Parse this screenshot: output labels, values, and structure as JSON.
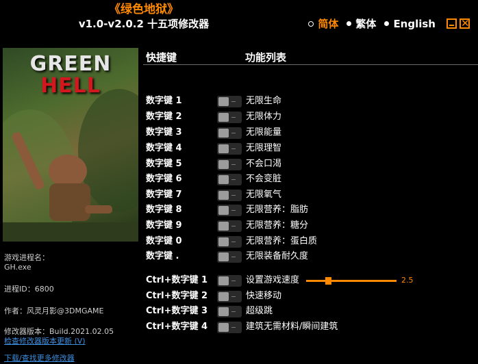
{
  "window": {
    "title_cn": "《绿色地狱》",
    "title_version": "v1.0-v2.0.2 十五项修改器"
  },
  "languages": [
    {
      "label": "简体",
      "selected": true
    },
    {
      "label": "繁体",
      "selected": false
    },
    {
      "label": "English",
      "selected": false
    }
  ],
  "cover": {
    "line1": "GREEN",
    "line2": "HELL"
  },
  "info": {
    "process_label": "游戏进程名：",
    "process_value": "GH.exe",
    "pid": "进程ID：6800",
    "author": "作者：风灵月影@3DMGAME",
    "build": "修改器版本：Build.2021.02.05",
    "check_update": "检查修改器版本更新 (V)",
    "download": "下载/查找更多修改器"
  },
  "headers": {
    "hotkey": "快捷键",
    "functions": "功能列表"
  },
  "cheats": [
    {
      "key": "数字键 1",
      "label": "无限生命"
    },
    {
      "key": "数字键 2",
      "label": "无限体力"
    },
    {
      "key": "数字键 3",
      "label": "无限能量"
    },
    {
      "key": "数字键 4",
      "label": "无限理智"
    },
    {
      "key": "数字键 5",
      "label": "不会口渴"
    },
    {
      "key": "数字键 6",
      "label": "不会变脏"
    },
    {
      "key": "数字键 7",
      "label": "无限氧气"
    },
    {
      "key": "数字键 8",
      "label": "无限营养：脂肪"
    },
    {
      "key": "数字键 9",
      "label": "无限营养：糖分"
    },
    {
      "key": "数字键 0",
      "label": "无限营养：蛋白质"
    },
    {
      "key": "数字键 .",
      "label": "无限装备耐久度"
    }
  ],
  "ctrl_cheats": [
    {
      "key": "Ctrl+数字键 1",
      "label": "设置游戏速度",
      "slider_value": "2.5"
    },
    {
      "key": "Ctrl+数字键 2",
      "label": "快速移动"
    },
    {
      "key": "Ctrl+数字键 3",
      "label": "超级跳"
    },
    {
      "key": "Ctrl+数字键 4",
      "label": "建筑无需材料/瞬间建筑"
    }
  ],
  "colors": {
    "accent": "#ff8a00",
    "link": "#3d8fe0",
    "background": "#000000"
  }
}
